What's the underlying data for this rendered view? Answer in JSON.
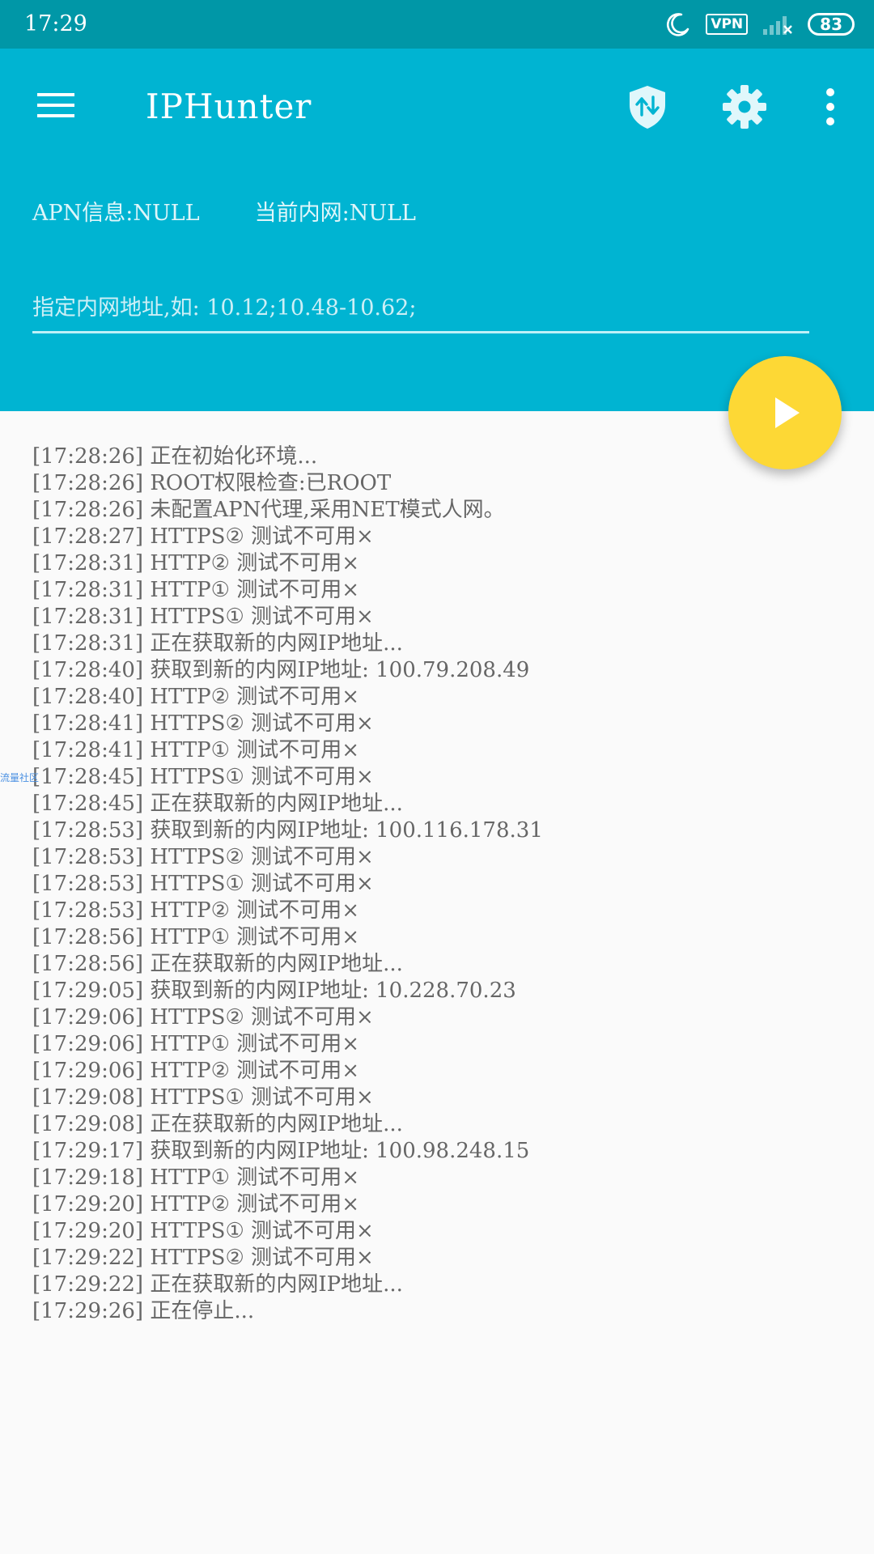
{
  "status_bar": {
    "time": "17:29",
    "vpn_label": "VPN",
    "battery": "83",
    "icons": [
      "moon-icon",
      "vpn-badge",
      "signal-icon",
      "battery-icon"
    ]
  },
  "app_bar": {
    "title": "IPHunter",
    "icons": [
      "menu-icon",
      "vpn-shield-icon",
      "gear-icon",
      "more-vert-icon"
    ]
  },
  "info": {
    "apn": "APN信息:NULL",
    "current_network": "当前内网:NULL"
  },
  "ip_input": {
    "placeholder": "指定内网地址,如: 10.12;10.48-10.62;",
    "value": ""
  },
  "fab": {
    "icon": "play-icon"
  },
  "log": [
    "[17:28:26] 正在初始化环境...",
    "[17:28:26] ROOT权限检查:已ROOT",
    "[17:28:26] 未配置APN代理,采用NET模式人网。",
    "[17:28:27] HTTPS② 测试不可用×",
    "[17:28:31] HTTP②  测试不可用×",
    "[17:28:31] HTTP①  测试不可用×",
    "[17:28:31] HTTPS① 测试不可用×",
    "[17:28:31] 正在获取新的内网IP地址...",
    "[17:28:40] 获取到新的内网IP地址: 100.79.208.49",
    "[17:28:40] HTTP②  测试不可用×",
    "[17:28:41] HTTPS② 测试不可用×",
    "[17:28:41] HTTP①  测试不可用×",
    "[17:28:45] HTTPS① 测试不可用×",
    "[17:28:45] 正在获取新的内网IP地址...",
    "[17:28:53] 获取到新的内网IP地址: 100.116.178.31",
    "[17:28:53] HTTPS② 测试不可用×",
    "[17:28:53] HTTPS① 测试不可用×",
    "[17:28:53] HTTP②  测试不可用×",
    "[17:28:56] HTTP①  测试不可用×",
    "[17:28:56] 正在获取新的内网IP地址...",
    "[17:29:05] 获取到新的内网IP地址: 10.228.70.23",
    "[17:29:06] HTTPS② 测试不可用×",
    "[17:29:06] HTTP①  测试不可用×",
    "[17:29:06] HTTP②  测试不可用×",
    "[17:29:08] HTTPS① 测试不可用×",
    "[17:29:08] 正在获取新的内网IP地址...",
    "[17:29:17] 获取到新的内网IP地址: 100.98.248.15",
    "[17:29:18] HTTP①  测试不可用×",
    "[17:29:20] HTTP②  测试不可用×",
    "[17:29:20] HTTPS① 测试不可用×",
    "[17:29:22] HTTPS② 测试不可用×",
    "[17:29:22] 正在获取新的内网IP地址...",
    "[17:29:26] 正在停止..."
  ],
  "watermark": "流量社区",
  "colors": {
    "status_bar": "#0097a7",
    "primary": "#00b4d2",
    "accent": "#fdd835",
    "log_text": "#666666",
    "background": "#fafafa"
  }
}
